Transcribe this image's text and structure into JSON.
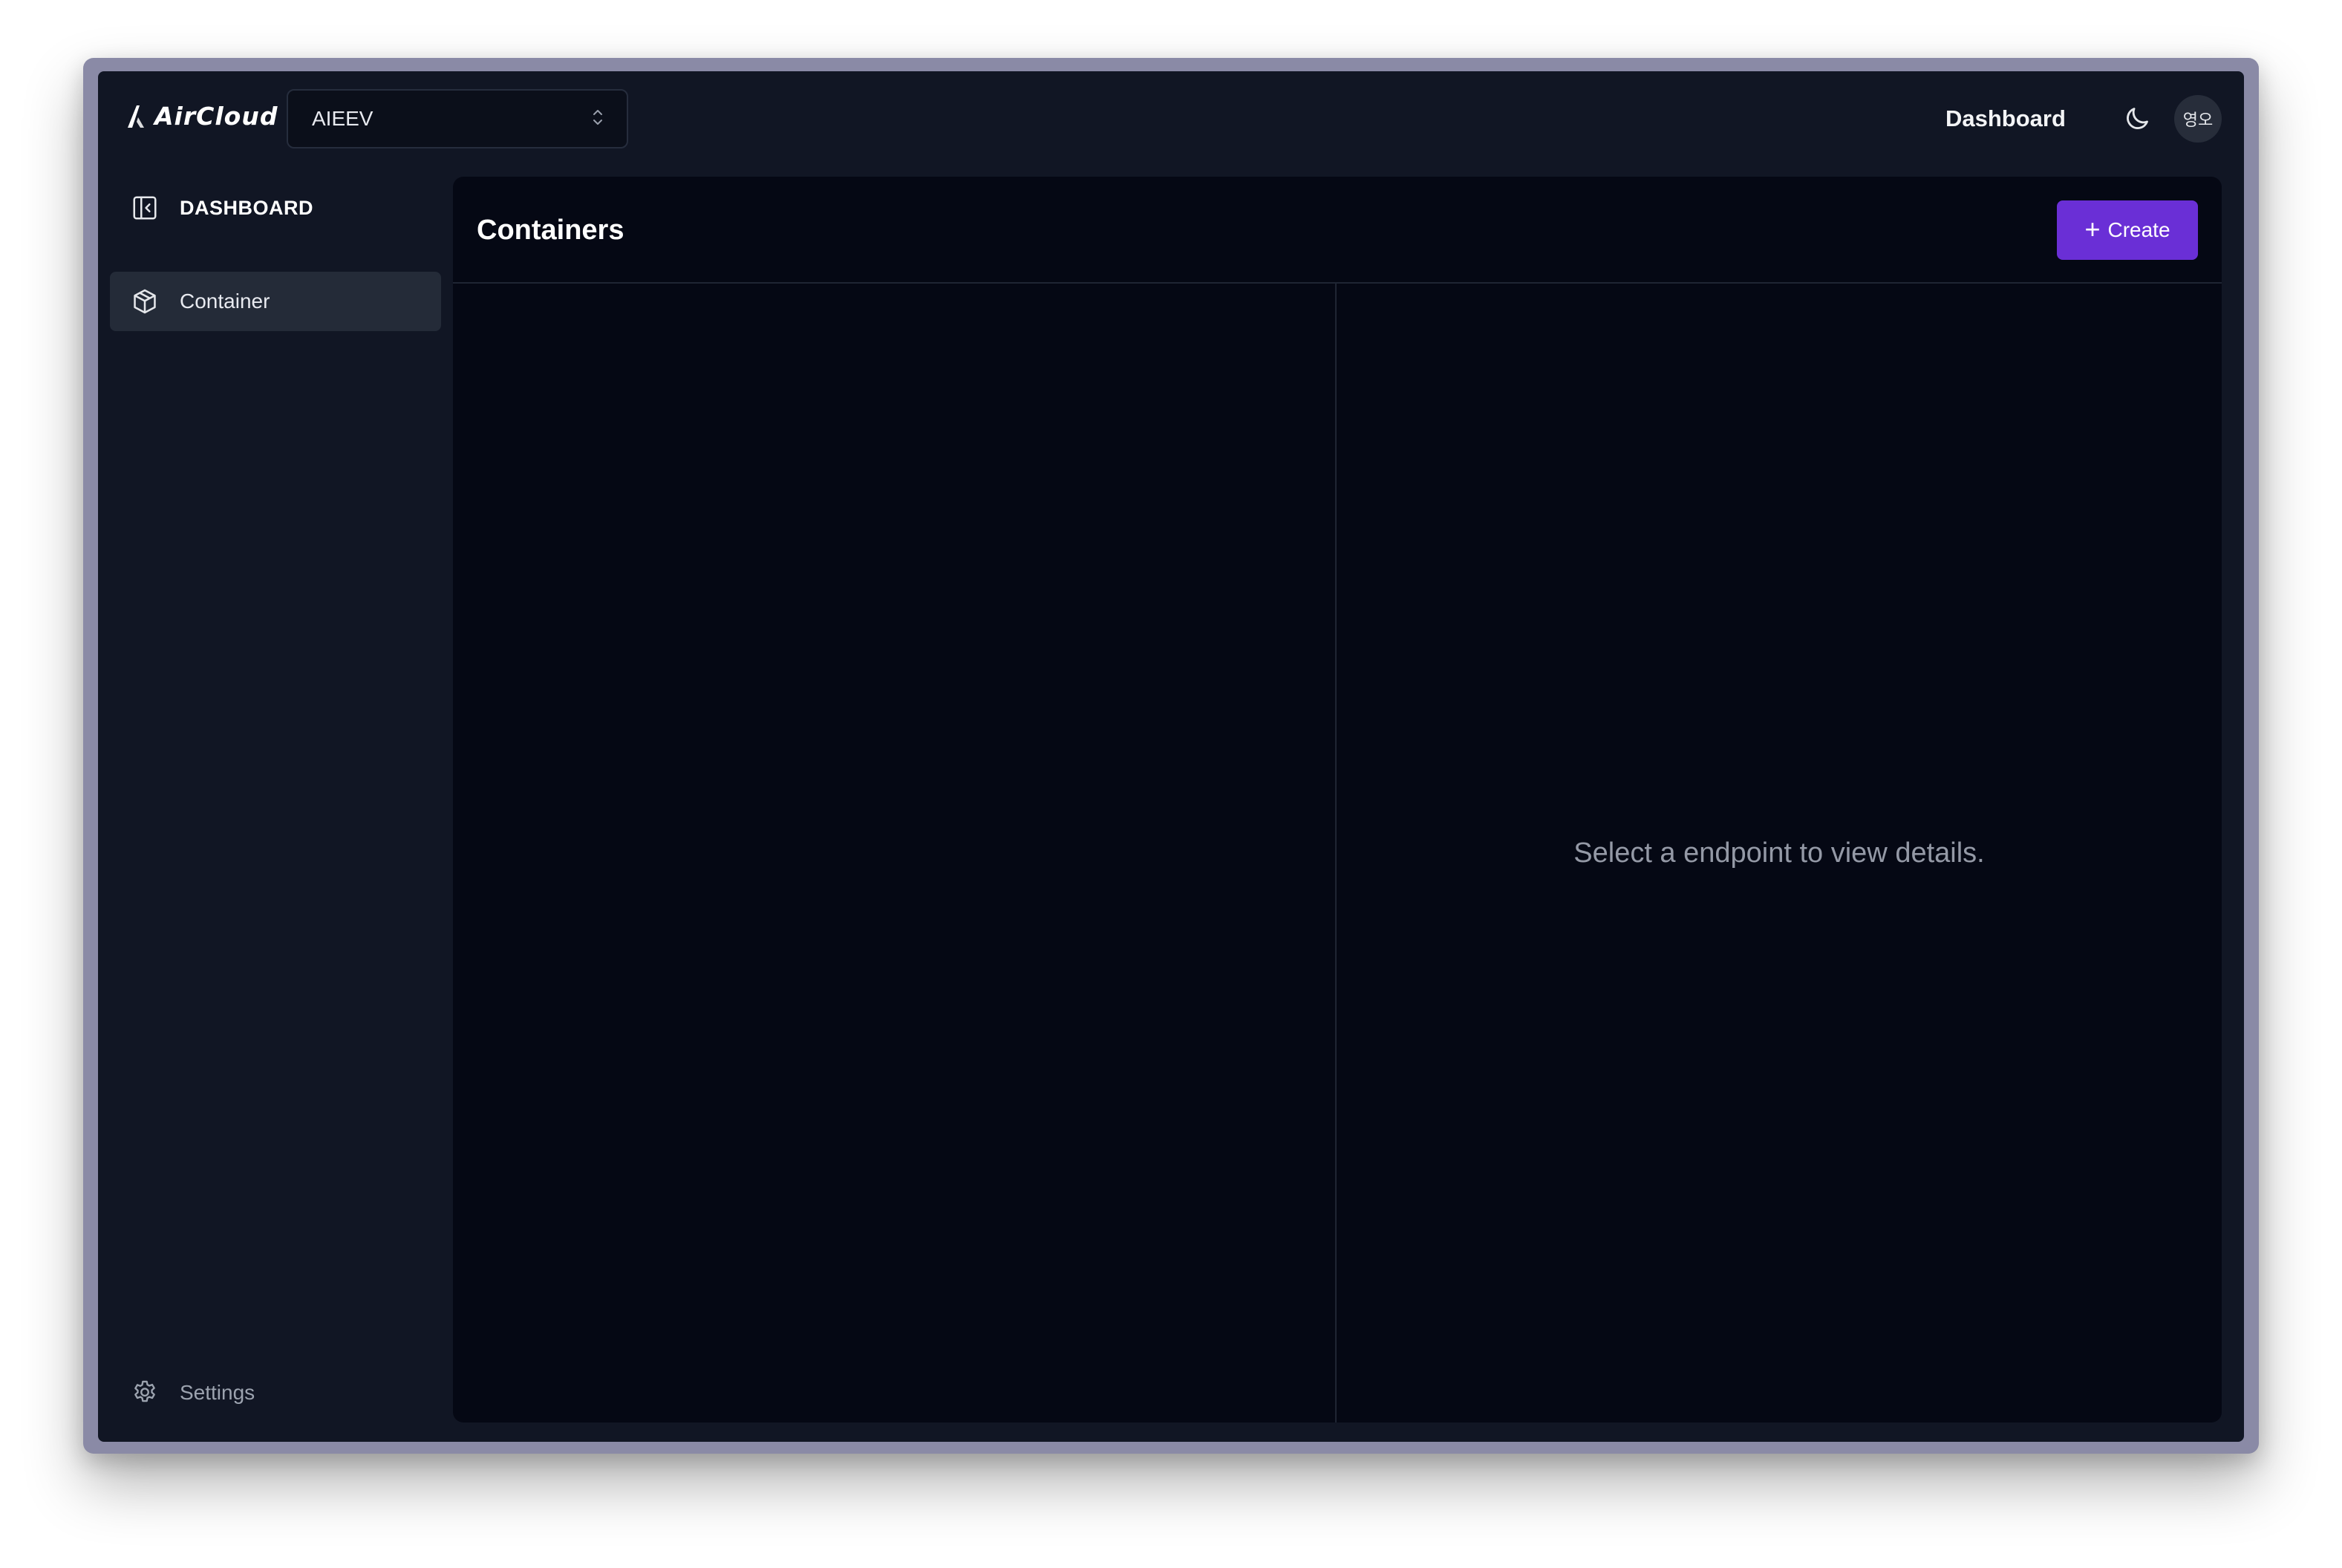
{
  "header": {
    "logo_text": "AirCloud",
    "org_select": {
      "value": "AIEEV"
    },
    "nav_link": "Dashboard",
    "avatar_initials": "영오"
  },
  "sidebar": {
    "heading": "DASHBOARD",
    "items": [
      {
        "label": "Container",
        "icon": "box-icon",
        "active": true
      }
    ],
    "footer": {
      "label": "Settings",
      "icon": "gear-icon"
    }
  },
  "main": {
    "title": "Containers",
    "create_label": "Create",
    "detail_empty": "Select a endpoint to view details."
  },
  "colors": {
    "accent": "#6a2fd6",
    "background": "#111624",
    "panel": "#050814"
  }
}
